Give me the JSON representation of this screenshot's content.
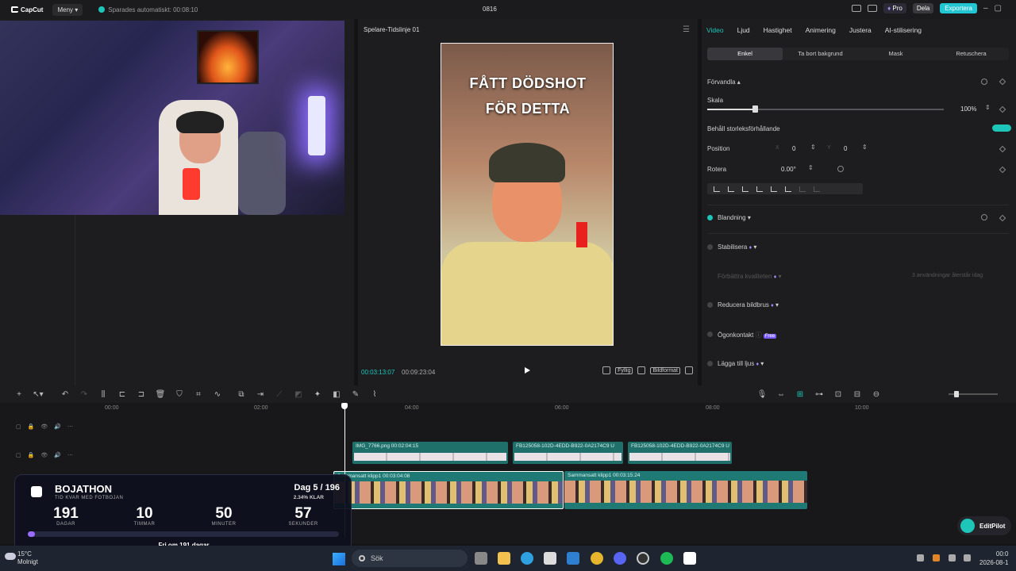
{
  "titlebar": {
    "app_name": "CapCut",
    "menu_label": "Meny",
    "save_status": "Sparades automatiskt: 00:08:10",
    "project_name": "0816",
    "pro_label": "Pro",
    "share_label": "Dela",
    "export_label": "Exportera"
  },
  "player": {
    "title": "Spelare-Tidslinje 01",
    "overlay_line1": "FÅTT DÖDSHOT",
    "overlay_line2": "FÖR DETTA",
    "current_time": "00:03:13:07",
    "total_time": "00:09:23:04",
    "full_label": "Fyllig",
    "ratio_label": "Bildformat"
  },
  "inspector": {
    "tabs": [
      "Video",
      "Ljud",
      "Hastighet",
      "Animering",
      "Justera",
      "AI-stilisering"
    ],
    "subtabs": [
      "Enkel",
      "Ta bort bakgrund",
      "Mask",
      "Retuschera"
    ],
    "transform_label": "Förvandla",
    "scale_label": "Skala",
    "scale_value": "100%",
    "keep_ratio_label": "Behåll storleksförhållande",
    "position_label": "Position",
    "pos_x_label": "X",
    "pos_x": "0",
    "pos_y_label": "Y",
    "pos_y": "0",
    "rotate_label": "Rotera",
    "rotate_value": "0.00°",
    "blend_label": "Blandning",
    "stabilize_label": "Stabilisera",
    "improve_label": "Förbättra kvaliteten",
    "improve_note": "3 användningar återstår idag",
    "reduce_noise_label": "Reducera bildbrus",
    "eye_contact_label": "Ögonkontakt",
    "free_badge": "Free",
    "add_light_label": "Lägga till ljus"
  },
  "timeline": {
    "ruler": [
      "00:00",
      "02:00",
      "04:00",
      "06:00",
      "08:00",
      "10:00"
    ],
    "clips_top": [
      {
        "name": "IMG_7766.png  00:02:04:15"
      },
      {
        "name": "FB125058-102D-4EDD-B922-0A2174C9 U"
      },
      {
        "name": "FB125058-102D-4EDD-B922-0A2174C9 U"
      }
    ],
    "clips_main": [
      {
        "name": "Sammansatt klipp1  00:03:04:08"
      },
      {
        "name": "Sammansatt klipp1  00:03:15:24"
      }
    ]
  },
  "bojathon": {
    "title": "BOJATHON",
    "subtitle": "TID KVAR MED FOTBOJAN",
    "day": "Dag 5 / 196",
    "percent": "2.34% KLAR",
    "progress": 0.0234,
    "days": "191",
    "days_label": "DAGAR",
    "hours": "10",
    "hours_label": "TIMMAR",
    "minutes": "50",
    "minutes_label": "MINUTER",
    "seconds": "57",
    "seconds_label": "SEKUNDER",
    "footer": "Fri om 191 dagar"
  },
  "editpilot": {
    "label": "EditPilot"
  },
  "taskbar": {
    "temperature": "15°C",
    "weather": "Molnigt",
    "search_placeholder": "Sök",
    "time": "00:0",
    "date": "2026-08-1"
  },
  "colors": {
    "accent": "#1dc6b8",
    "pro": "#a48bff",
    "export": "#22c6d3"
  }
}
